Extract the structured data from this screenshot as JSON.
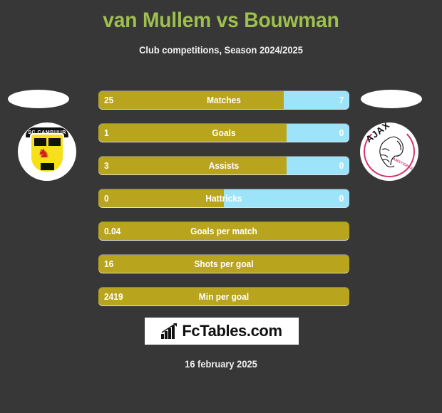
{
  "header": {
    "title": "van Mullem vs Bouwman",
    "subtitle": "Club competitions, Season 2024/2025"
  },
  "teams": {
    "home": {
      "badge_name": "sc-cambuur-badge",
      "badge_text": "SC CAMBUUR",
      "color": "#f5e01a"
    },
    "away": {
      "badge_name": "ajax-badge",
      "badge_text": "AJAX",
      "badge_subtext": "AMSTERDAM",
      "color": "#d6336c"
    }
  },
  "colors": {
    "background": "#373737",
    "title": "#9fbf4d",
    "home_bar": "#b9a41d",
    "away_bar": "#9de4fb",
    "text": "#ffffff"
  },
  "stats": [
    {
      "label": "Matches",
      "home": "25",
      "away": "7",
      "home_pct": 74,
      "split": true
    },
    {
      "label": "Goals",
      "home": "1",
      "away": "0",
      "home_pct": 75,
      "split": true
    },
    {
      "label": "Assists",
      "home": "3",
      "away": "0",
      "home_pct": 75,
      "split": true
    },
    {
      "label": "Hattricks",
      "home": "0",
      "away": "0",
      "home_pct": 50,
      "split": true
    },
    {
      "label": "Goals per match",
      "home": "0.04",
      "away": "",
      "home_pct": 100,
      "split": false
    },
    {
      "label": "Shots per goal",
      "home": "16",
      "away": "",
      "home_pct": 100,
      "split": false
    },
    {
      "label": "Min per goal",
      "home": "2419",
      "away": "",
      "home_pct": 100,
      "split": false
    }
  ],
  "footer": {
    "logo_text": "FcTables.com",
    "logo_icon": "bar-chart-icon",
    "date": "16 february 2025"
  }
}
